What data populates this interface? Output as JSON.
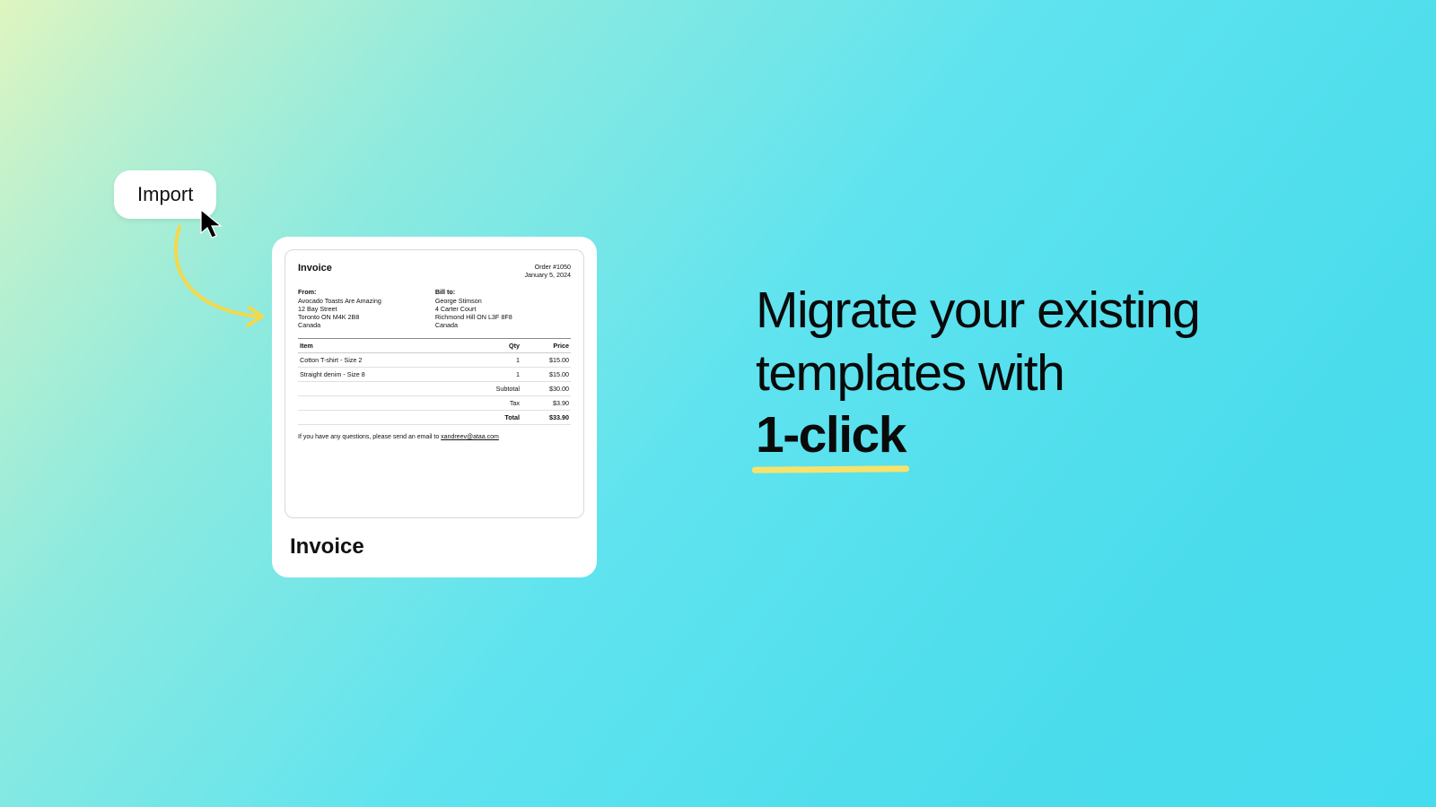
{
  "import_button": {
    "label": "Import"
  },
  "headline": {
    "line1": "Migrate your existing",
    "line2": "templates with",
    "highlight": "1-click"
  },
  "card": {
    "caption": "Invoice",
    "preview": {
      "title": "Invoice",
      "order_number": "Order #1050",
      "date": "January 5, 2024",
      "from": {
        "heading": "From:",
        "name": "Avocado Toasts Are Amazing",
        "street": "12 Bay Street",
        "city": "Toronto ON M4K 2B8",
        "country": "Canada"
      },
      "bill_to": {
        "heading": "Bill to:",
        "name": "George Stimson",
        "street": "4 Carter Court",
        "city": "Richmond Hill ON L3F 8F8",
        "country": "Canada"
      },
      "columns": {
        "item": "Item",
        "qty": "Qty",
        "price": "Price"
      },
      "items": [
        {
          "name": "Cotton T-shirt - Size 2",
          "qty": "1",
          "price": "$15.00"
        },
        {
          "name": "Straight denim  - Size 8",
          "qty": "1",
          "price": "$15.00"
        }
      ],
      "subtotal": {
        "label": "Subtotal",
        "value": "$30.00"
      },
      "tax": {
        "label": "Tax",
        "value": "$3.90"
      },
      "total": {
        "label": "Total",
        "value": "$33.90"
      },
      "footnote_prefix": "If you have any questions, please send an email to ",
      "footnote_email": "xandreev@ataa.com"
    }
  }
}
